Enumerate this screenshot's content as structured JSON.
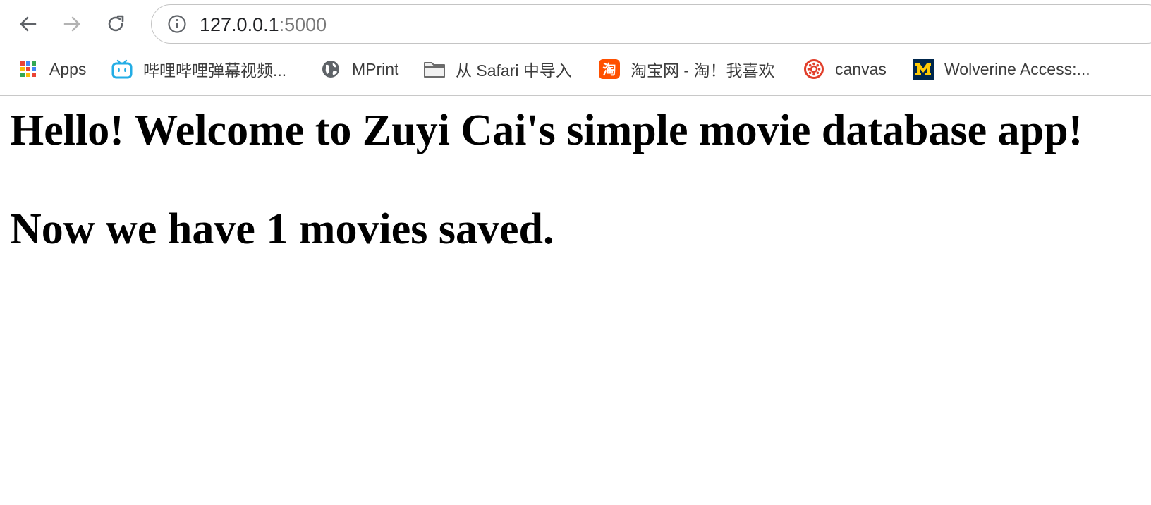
{
  "browser": {
    "url_host": "127.0.0.1",
    "url_port": ":5000",
    "icons": {
      "back": "arrow-left",
      "forward": "arrow-right",
      "reload": "reload",
      "site_info": "info-circle"
    }
  },
  "bookmarks": [
    {
      "label": "Apps",
      "icon": "apps-grid"
    },
    {
      "label": "哔哩哔哩弹幕视频...",
      "icon": "bilibili-tv"
    },
    {
      "label": "MPrint",
      "icon": "globe"
    },
    {
      "label": "从 Safari 中导入",
      "icon": "folder"
    },
    {
      "label": "淘宝网 - 淘！我喜欢",
      "icon": "taobao"
    },
    {
      "label": "canvas",
      "icon": "canvas"
    },
    {
      "label": "Wolverine Access:...",
      "icon": "michigan-m"
    }
  ],
  "page": {
    "heading_welcome": "Hello! Welcome to Zuyi Cai's simple movie database app!",
    "heading_count": "Now we have 1 movies saved."
  },
  "colors": {
    "bilibili": "#23ade5",
    "taobao": "#ff5000",
    "canvas": "#e13f2b",
    "michigan_blue": "#00274c",
    "michigan_maize": "#ffcb05"
  }
}
